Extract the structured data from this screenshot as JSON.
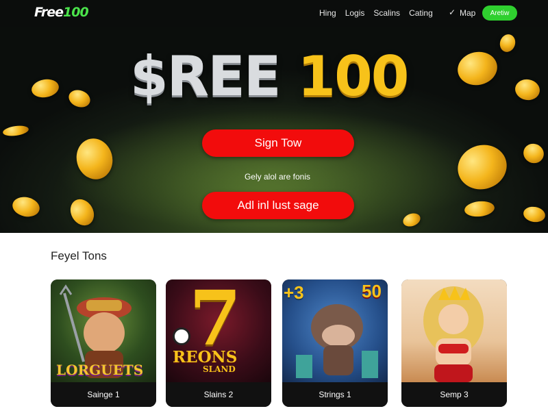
{
  "nav": {
    "logo_main": "Free",
    "logo_accent": "100",
    "links": [
      "Hing",
      "Logis",
      "Scalins",
      "Cating"
    ],
    "check_glyph": "✓",
    "map_label": "Map",
    "cta_label": "Aretiw"
  },
  "hero": {
    "title_silver": "$REE",
    "title_gold": "100",
    "primary_button": "Sign Tow",
    "subtitle": "Gely alol are fonis",
    "secondary_button": "Adl inl lust sage"
  },
  "section": {
    "title": "Feyel Tons",
    "cards": [
      {
        "label": "Sainge 1",
        "art_text": "LORGUETS"
      },
      {
        "label": "Slains 2",
        "art_big": "7",
        "art_text": "REONS",
        "art_sub": "SLAND"
      },
      {
        "label": "Strings 1",
        "art_badge_left": "+3",
        "art_badge_right": "50"
      },
      {
        "label": "Semp 3"
      }
    ]
  },
  "colors": {
    "nav_bg": "#0b0d0c",
    "accent_green": "#2fd02f",
    "button_red": "#f20c0c",
    "gold": "#f7c21a"
  }
}
